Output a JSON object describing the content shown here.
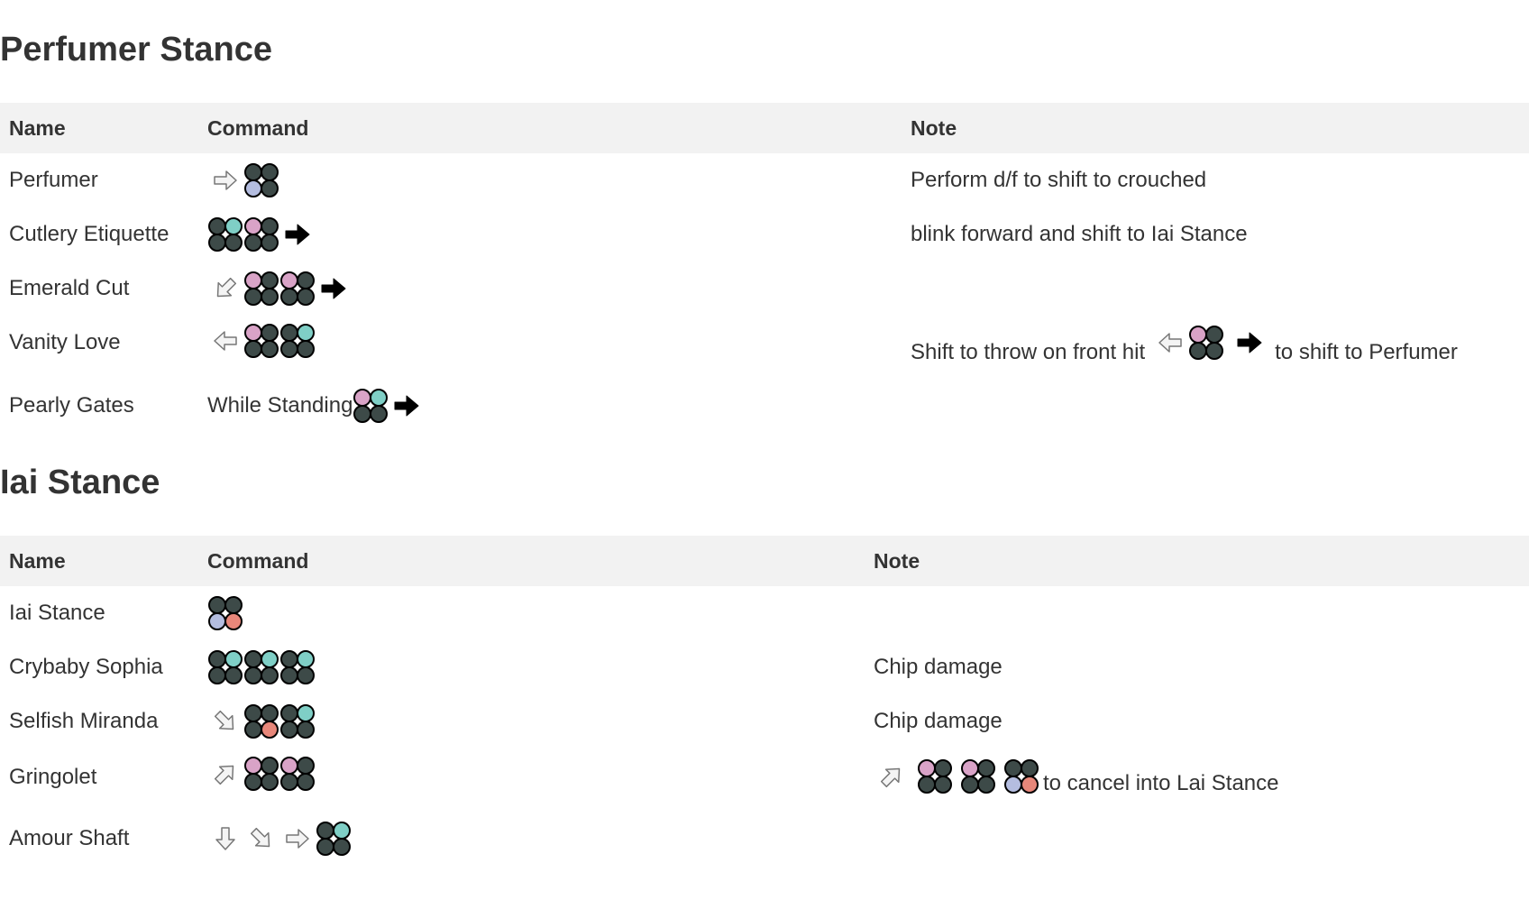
{
  "colors": {
    "dark": "#3d4a48",
    "pink": "#d9a3c7",
    "teal": "#7fcfc6",
    "blue": "#b4bde0",
    "red": "#e8877a",
    "header_bg": "#f2f2f2"
  },
  "sections": [
    {
      "title": "Perfumer Stance",
      "headers": {
        "name": "Name",
        "command": "Command",
        "note": "Note"
      },
      "rows": [
        {
          "name": "Perfumer",
          "note": "Perform d/f to shift to crouched"
        },
        {
          "name": "Cutlery Etiquette",
          "note": "blink forward and shift to Iai Stance"
        },
        {
          "name": "Emerald Cut",
          "note": ""
        },
        {
          "name": "Vanity Love",
          "note_pre": "Shift to throw on front hit",
          "note_post": "to shift to Perfumer"
        },
        {
          "name": "Pearly Gates",
          "command_text": "While Standing",
          "note": ""
        }
      ]
    },
    {
      "title": "Iai Stance",
      "headers": {
        "name": "Name",
        "command": "Command",
        "note": "Note"
      },
      "rows": [
        {
          "name": "Iai Stance",
          "note": ""
        },
        {
          "name": "Crybaby Sophia",
          "note": "Chip damage"
        },
        {
          "name": "Selfish Miranda",
          "note": "Chip damage"
        },
        {
          "name": "Gringolet",
          "note_post": "to cancel into Lai Stance"
        },
        {
          "name": "Amour Shaft",
          "note": ""
        }
      ]
    }
  ],
  "icons": [
    "arrow-forward-icon",
    "arrow-back-icon",
    "arrow-down-icon",
    "arrow-down-forward-icon",
    "arrow-up-forward-icon",
    "arrow-down-back-icon",
    "filled-arrow-icon",
    "button-grid-icon"
  ]
}
